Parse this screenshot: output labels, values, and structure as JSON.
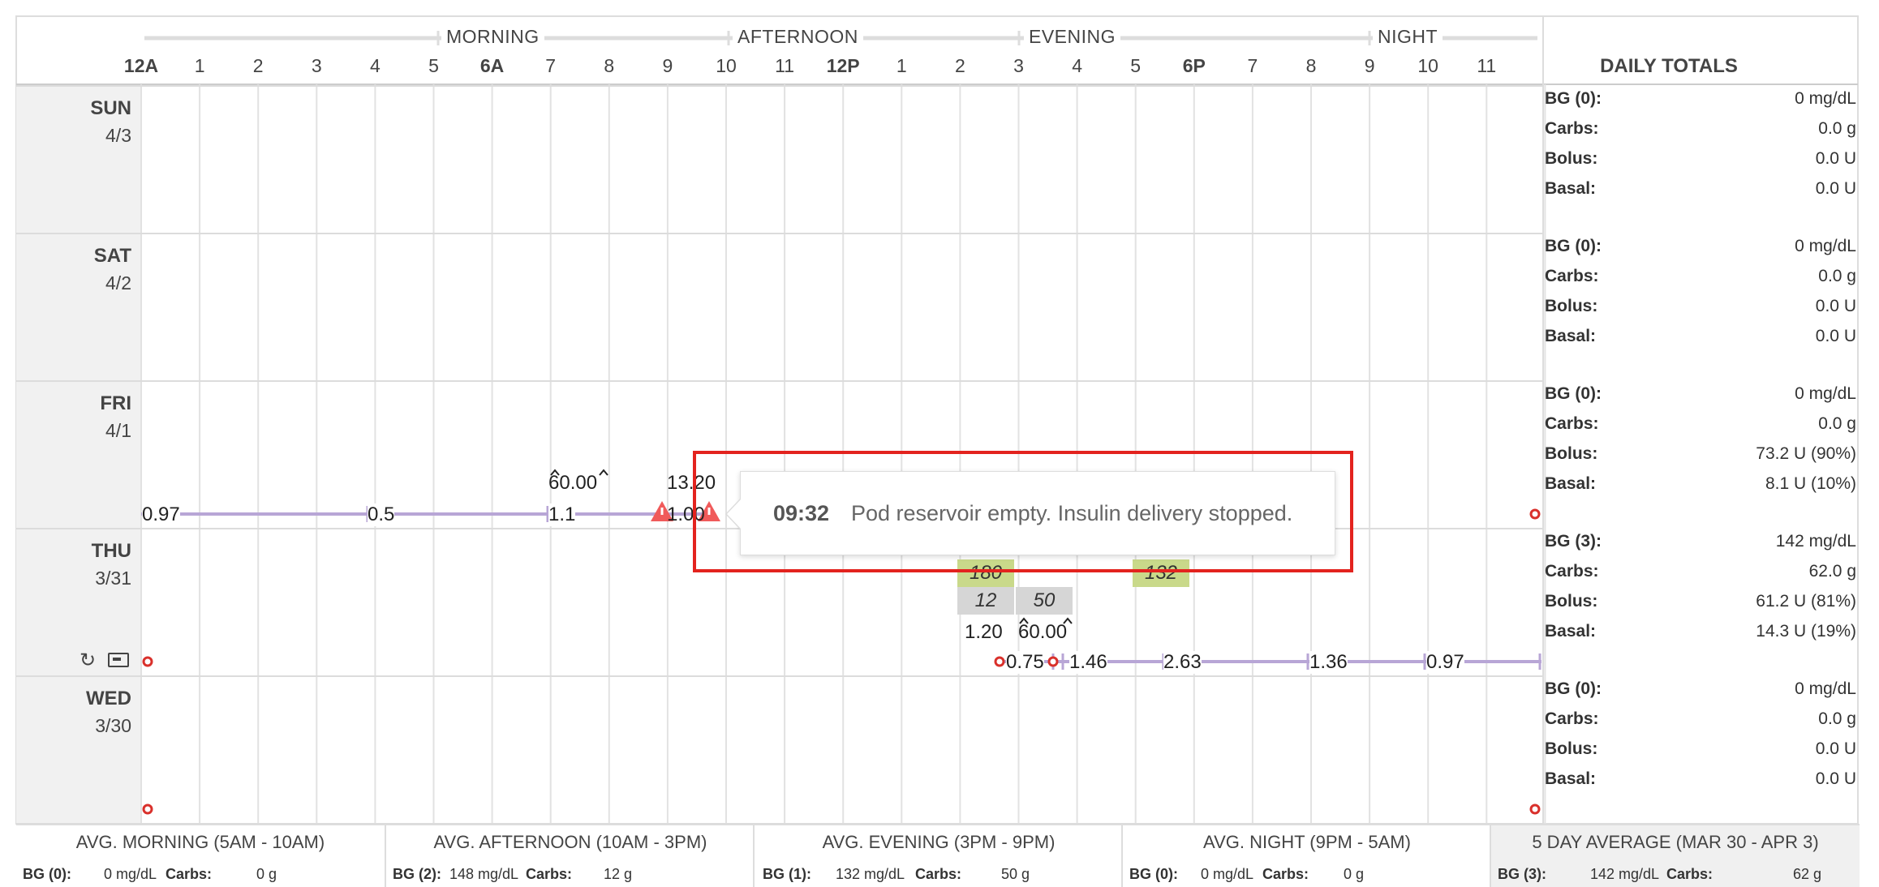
{
  "hours": [
    "12A",
    "1",
    "2",
    "3",
    "4",
    "5",
    "6A",
    "7",
    "8",
    "9",
    "10",
    "11",
    "12P",
    "1",
    "2",
    "3",
    "4",
    "5",
    "6P",
    "7",
    "8",
    "9",
    "10",
    "11"
  ],
  "periods": [
    "MORNING",
    "AFTERNOON",
    "EVENING",
    "NIGHT"
  ],
  "daily_totals_title": "DAILY TOTALS",
  "days": [
    {
      "name": "SUN",
      "date": "4/3",
      "bg_label": "BG (0):",
      "bg": "0 mg/dL",
      "carbs_label": "Carbs:",
      "carbs": "0.0 g",
      "bolus_label": "Bolus:",
      "bolus": "0.0 U",
      "basal_label": "Basal:",
      "basal": "0.0 U"
    },
    {
      "name": "SAT",
      "date": "4/2",
      "bg_label": "BG (0):",
      "bg": "0 mg/dL",
      "carbs_label": "Carbs:",
      "carbs": "0.0 g",
      "bolus_label": "Bolus:",
      "bolus": "0.0 U",
      "basal_label": "Basal:",
      "basal": "0.0 U"
    },
    {
      "name": "FRI",
      "date": "4/1",
      "bg_label": "BG (0):",
      "bg": "0 mg/dL",
      "carbs_label": "Carbs:",
      "carbs": "0.0 g",
      "bolus_label": "Bolus:",
      "bolus": "73.2 U (90%)",
      "basal_label": "Basal:",
      "basal": "8.1 U (10%)"
    },
    {
      "name": "THU",
      "date": "3/31",
      "bg_label": "BG (3):",
      "bg": "142 mg/dL",
      "carbs_label": "Carbs:",
      "carbs": "62.0 g",
      "bolus_label": "Bolus:",
      "bolus": "61.2 U (81%)",
      "basal_label": "Basal:",
      "basal": "14.3 U (19%)"
    },
    {
      "name": "WED",
      "date": "3/30",
      "bg_label": "BG (0):",
      "bg": "0 mg/dL",
      "carbs_label": "Carbs:",
      "carbs": "0.0 g",
      "bolus_label": "Bolus:",
      "bolus": "0.0 U",
      "basal_label": "Basal:",
      "basal": "0.0 U"
    }
  ],
  "fri": {
    "bolus1": "60.00",
    "bolus2": "13.20",
    "basal_rates": [
      "0.97",
      "0.5",
      "1.1",
      "1.00"
    ]
  },
  "thu": {
    "bg1": "180",
    "bg2": "132",
    "carbs1": "12",
    "carbs2": "50",
    "bolus1": "1.20",
    "bolus2": "60.00",
    "basal_rates": [
      "0.75",
      "1.46",
      "2.63",
      "1.36",
      "0.97"
    ]
  },
  "tooltip": {
    "time": "09:32",
    "message": "Pod reservoir empty. Insulin delivery stopped."
  },
  "footer": [
    {
      "title": "AVG. MORNING (5AM - 10AM)",
      "bg_label": "BG (0):",
      "bg": "0 mg/dL",
      "carbs_label": "Carbs:",
      "carbs": "0 g"
    },
    {
      "title": "AVG. AFTERNOON (10AM - 3PM)",
      "bg_label": "BG (2):",
      "bg": "148 mg/dL",
      "carbs_label": "Carbs:",
      "carbs": "12 g"
    },
    {
      "title": "AVG. EVENING (3PM - 9PM)",
      "bg_label": "BG (1):",
      "bg": "132 mg/dL",
      "carbs_label": "Carbs:",
      "carbs": "50 g"
    },
    {
      "title": "AVG. NIGHT (9PM - 5AM)",
      "bg_label": "BG (0):",
      "bg": "0 mg/dL",
      "carbs_label": "Carbs:",
      "carbs": "0 g"
    },
    {
      "title": "5 DAY AVERAGE (MAR 30 - APR 3)",
      "bg_label": "BG (3):",
      "bg": "142 mg/dL",
      "carbs_label": "Carbs:",
      "carbs": "62 g"
    }
  ],
  "colors": {
    "basal": "#b8a6d6",
    "bg_cell": "#c9d98a",
    "carb_cell": "#d6d6d6",
    "alarm": "#f05a5a",
    "marker": "#d9302b",
    "tooltip_box": "#e3231e"
  },
  "icons": [
    "refresh-icon",
    "pod-icon",
    "warning-icon",
    "bolus-arrow-icon"
  ]
}
